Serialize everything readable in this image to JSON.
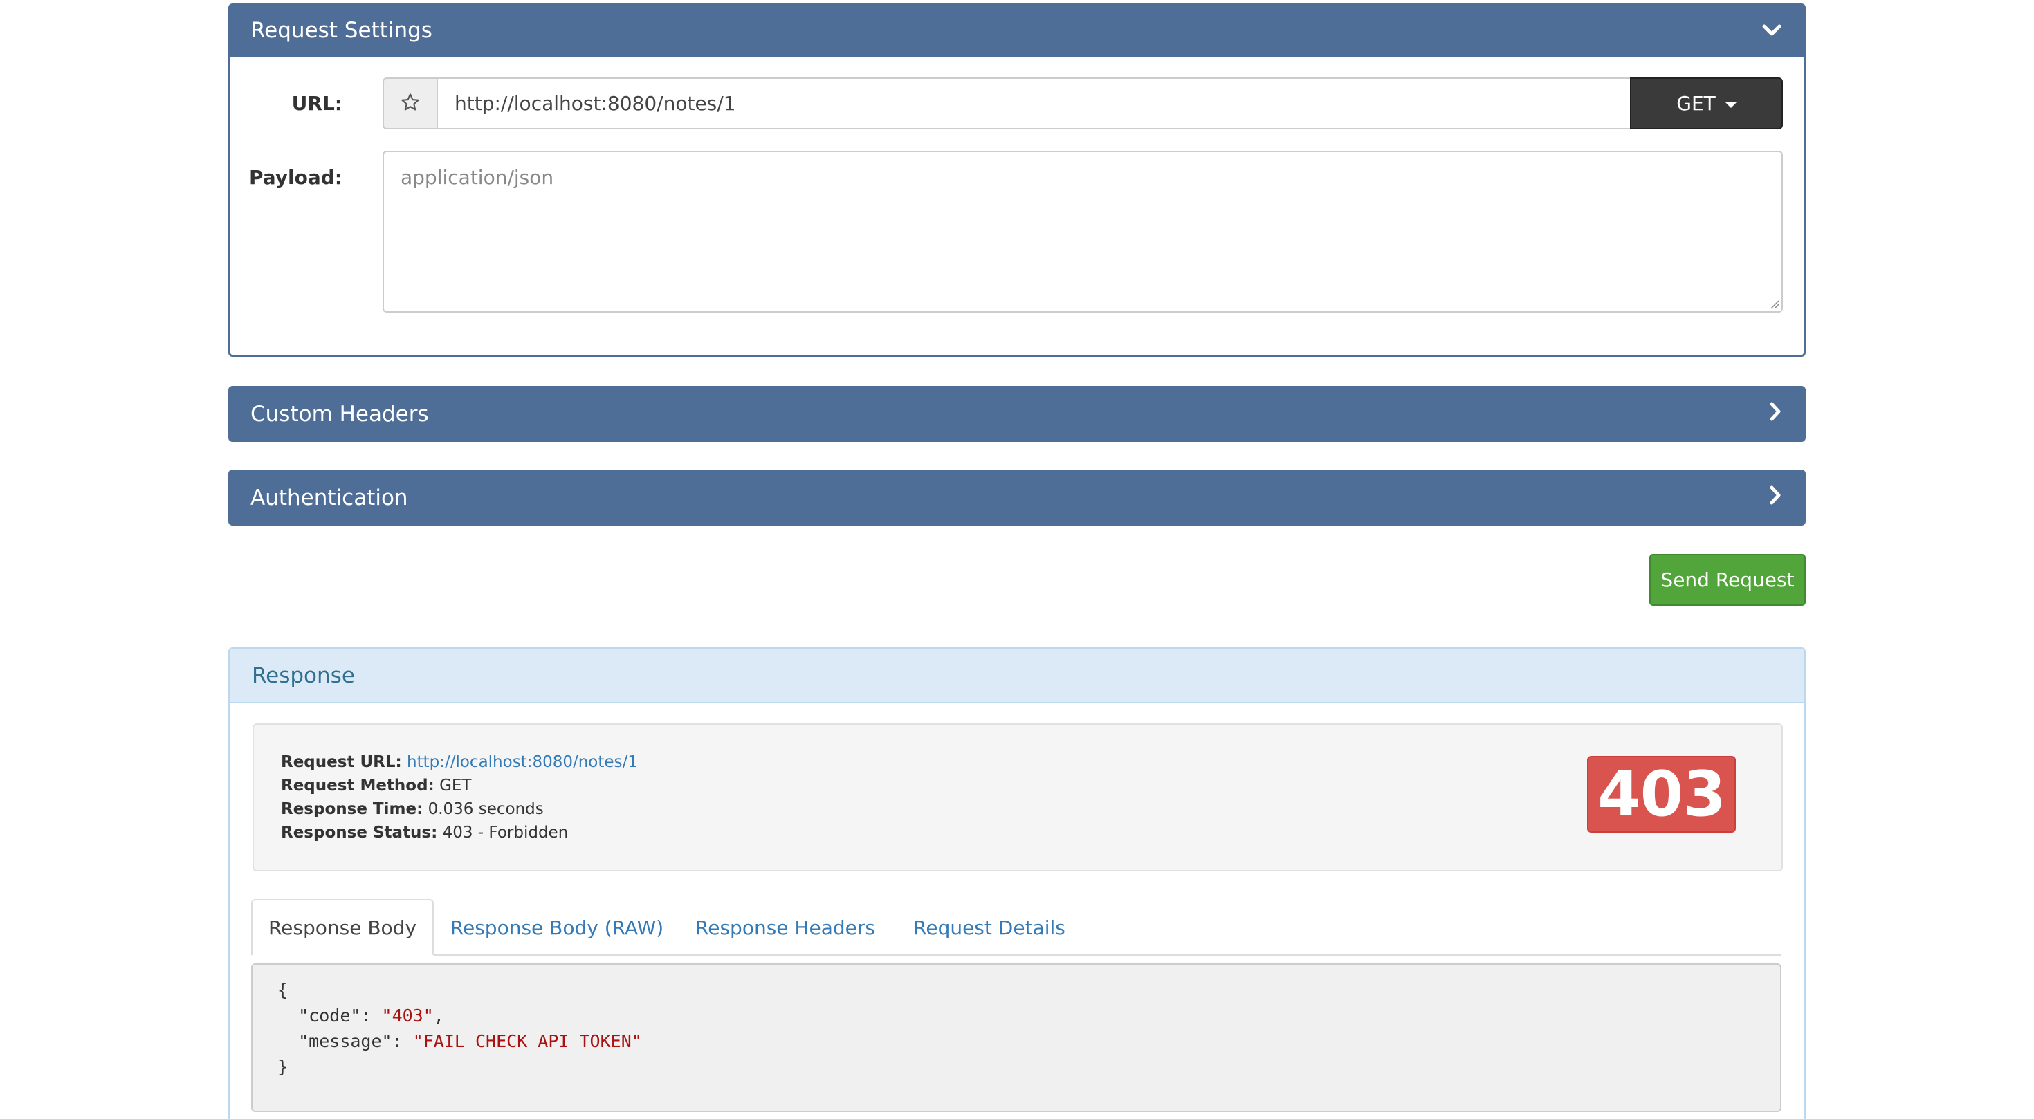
{
  "request_settings": {
    "title": "Request Settings",
    "url_label": "URL:",
    "url_value": "http://localhost:8080/notes/1",
    "method": "GET",
    "payload_label": "Payload:",
    "payload_placeholder": "application/json"
  },
  "custom_headers": {
    "title": "Custom Headers"
  },
  "authentication": {
    "title": "Authentication"
  },
  "send_button_label": "Send Request",
  "response": {
    "title": "Response",
    "request_url_label": "Request URL:",
    "request_url": "http://localhost:8080/notes/1",
    "request_method_label": "Request Method:",
    "request_method": "GET",
    "response_time_label": "Response Time:",
    "response_time": "0.036 seconds",
    "response_status_label": "Response Status:",
    "response_status": "403 - Forbidden",
    "status_code": "403",
    "tabs": [
      "Response Body",
      "Response Body (RAW)",
      "Response Headers",
      "Request Details"
    ],
    "body": {
      "open_brace": "{",
      "code_key": "\"code\"",
      "code_value": "\"403\"",
      "message_key": "\"message\"",
      "message_value": "\"FAIL CHECK API TOKEN\"",
      "close_brace": "}"
    }
  },
  "icons": {
    "star": "star-icon",
    "chevron_down": "chevron-down-icon",
    "chevron_right": "chevron-right-icon",
    "caret": "caret-down-icon"
  },
  "colors": {
    "panel_header": "#4e6e98",
    "send_button": "#52a53a",
    "status_badge": "#d9534f",
    "link": "#337ab7",
    "response_header_bg": "#dbeaf6"
  }
}
